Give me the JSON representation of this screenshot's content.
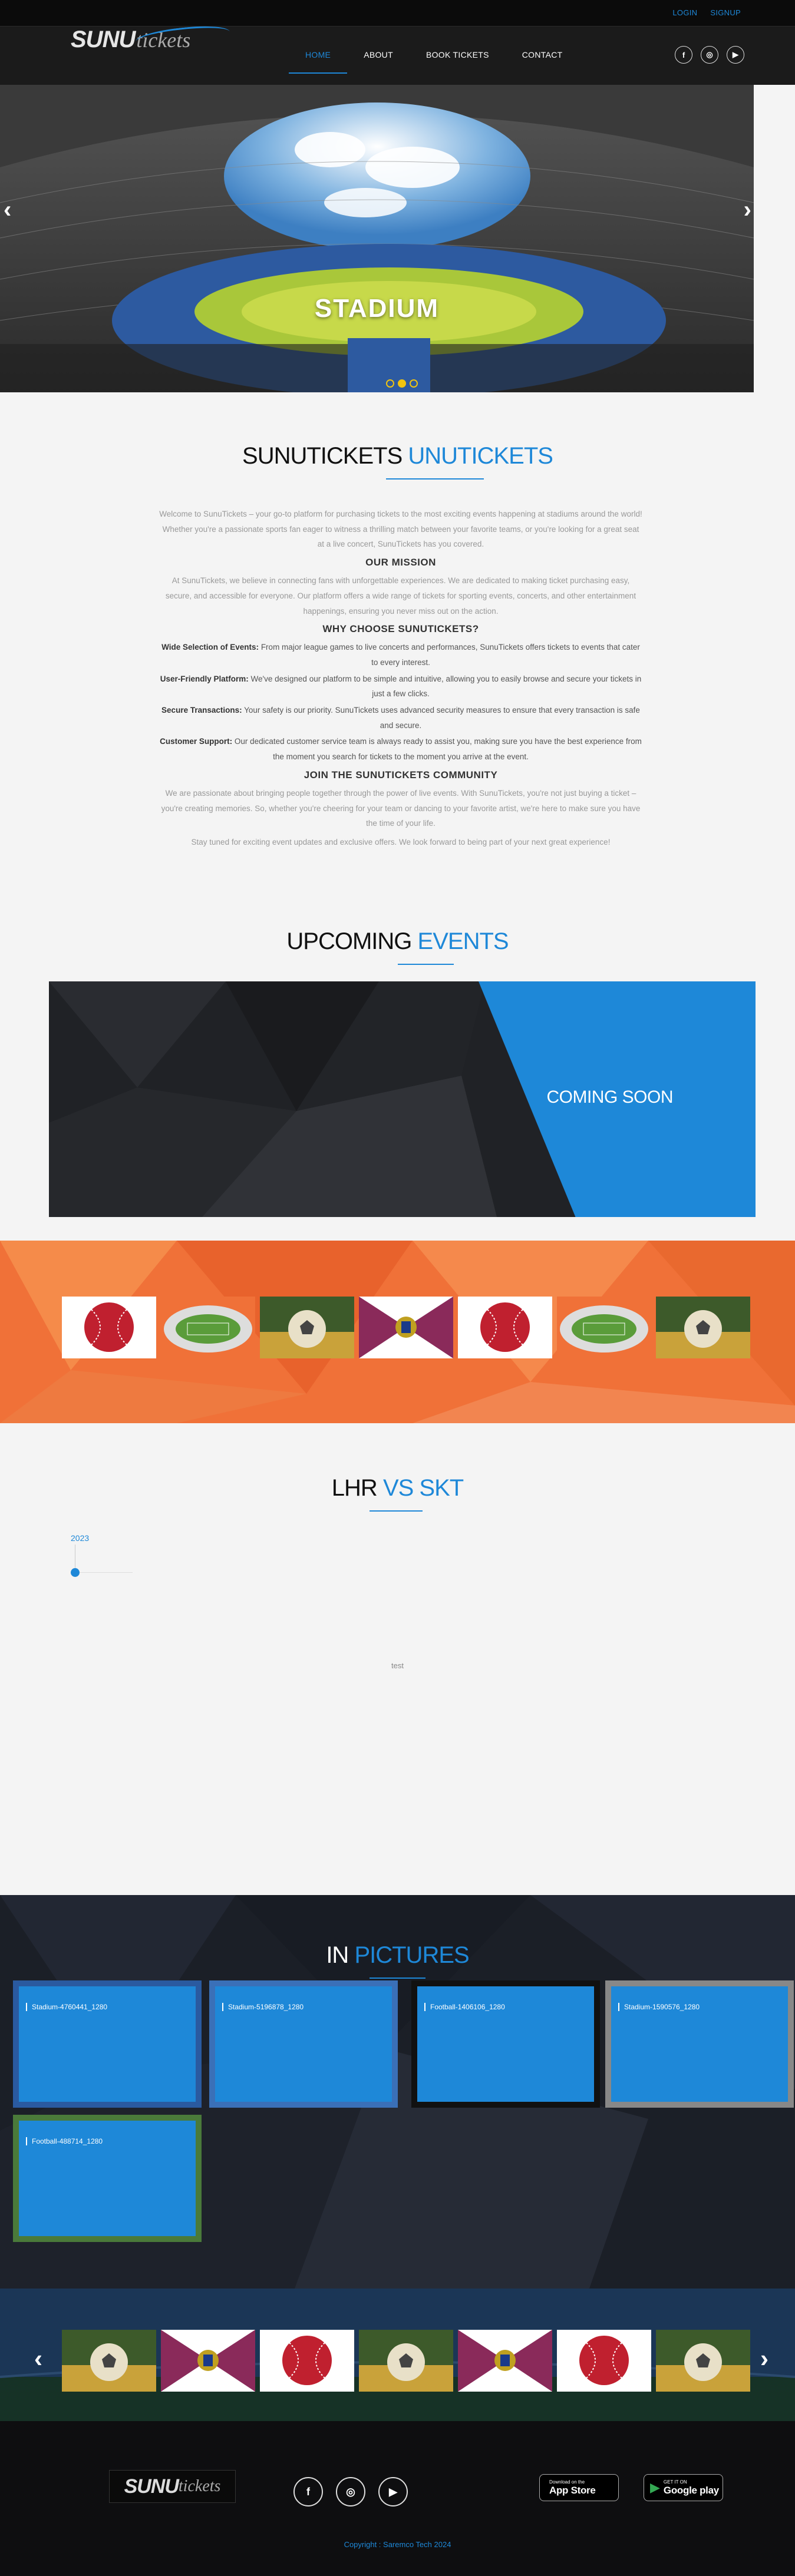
{
  "topbar": {
    "login": "LOGIN",
    "signup": "SIGNUP"
  },
  "brand": {
    "name_bold": "SUNU",
    "name_script": "tickets"
  },
  "nav": {
    "items": [
      "HOME",
      "ABOUT",
      "BOOK TICKETS",
      "CONTACT"
    ],
    "active": "HOME"
  },
  "social": {
    "icons": [
      "facebook-icon",
      "instagram-icon",
      "youtube-icon"
    ],
    "glyphs": [
      "f",
      "◎",
      "▶"
    ]
  },
  "hero": {
    "title": "STADIUM",
    "slides": 3,
    "active_slide": 2
  },
  "about": {
    "title_dark": "SUNUTICKETS",
    "title_blue": "UNUTICKETS",
    "intro": "Welcome to SunuTickets – your go-to platform for purchasing tickets to the most exciting events happening at stadiums around the world! Whether you're a passionate sports fan eager to witness a thrilling match between your favorite teams, or you're looking for a great seat at a live concert, SunuTickets has you covered.",
    "mission_heading": "OUR MISSION",
    "mission_text": "At SunuTickets, we believe in connecting fans with unforgettable experiences. We are dedicated to making ticket purchasing easy, secure, and accessible for everyone. Our platform offers a wide range of tickets for sporting events, concerts, and other entertainment happenings, ensuring you never miss out on the action.",
    "why_heading": "WHY CHOOSE SUNUTICKETS?",
    "reasons": [
      {
        "label": "Wide Selection of Events:",
        "text": " From major league games to live concerts and performances, SunuTickets offers tickets to events that cater to every interest."
      },
      {
        "label": "User-Friendly Platform:",
        "text": " We've designed our platform to be simple and intuitive, allowing you to easily browse and secure your tickets in just a few clicks."
      },
      {
        "label": "Secure Transactions:",
        "text": " Your safety is our priority. SunuTickets uses advanced security measures to ensure that every transaction is safe and secure."
      },
      {
        "label": "Customer Support:",
        "text": " Our dedicated customer service team is always ready to assist you, making sure you have the best experience from the moment you search for tickets to the moment you arrive at the event."
      }
    ],
    "community_heading": "JOIN THE SUNUTICKETS COMMUNITY",
    "community_text": "We are passionate about bringing people together through the power of live events. With SunuTickets, you're not just buying a ticket – you're creating memories. So, whether you're cheering for your team or dancing to your favorite artist, we're here to make sure you have the time of your life.",
    "closing": "Stay tuned for exciting event updates and exclusive offers. We look forward to being part of your next great experience!"
  },
  "upcoming": {
    "title_dark": "UPCOMING",
    "title_blue": "EVENTS",
    "banner": "COMING SOON"
  },
  "match": {
    "title_dark": "LHR",
    "title_blue": "VS SKT",
    "year": "2023",
    "content": "test"
  },
  "pictures": {
    "title_dark": "IN",
    "title_blue": "PICTURES",
    "items": [
      "Stadium-4760441_1280",
      "Stadium-5196878_1280",
      "Football-1406106_1280",
      "Stadium-1590576_1280",
      "Football-488714_1280"
    ]
  },
  "footer": {
    "appstore_small": "Download on the",
    "appstore_big": "App Store",
    "googleplay_small": "GET IT ON",
    "googleplay_big": "Google play",
    "copyright": "Copyright : Saremco Tech 2024"
  },
  "colors": {
    "accent": "#1e88d8",
    "orange": "#f07138",
    "dark": "#1b1b1b"
  }
}
